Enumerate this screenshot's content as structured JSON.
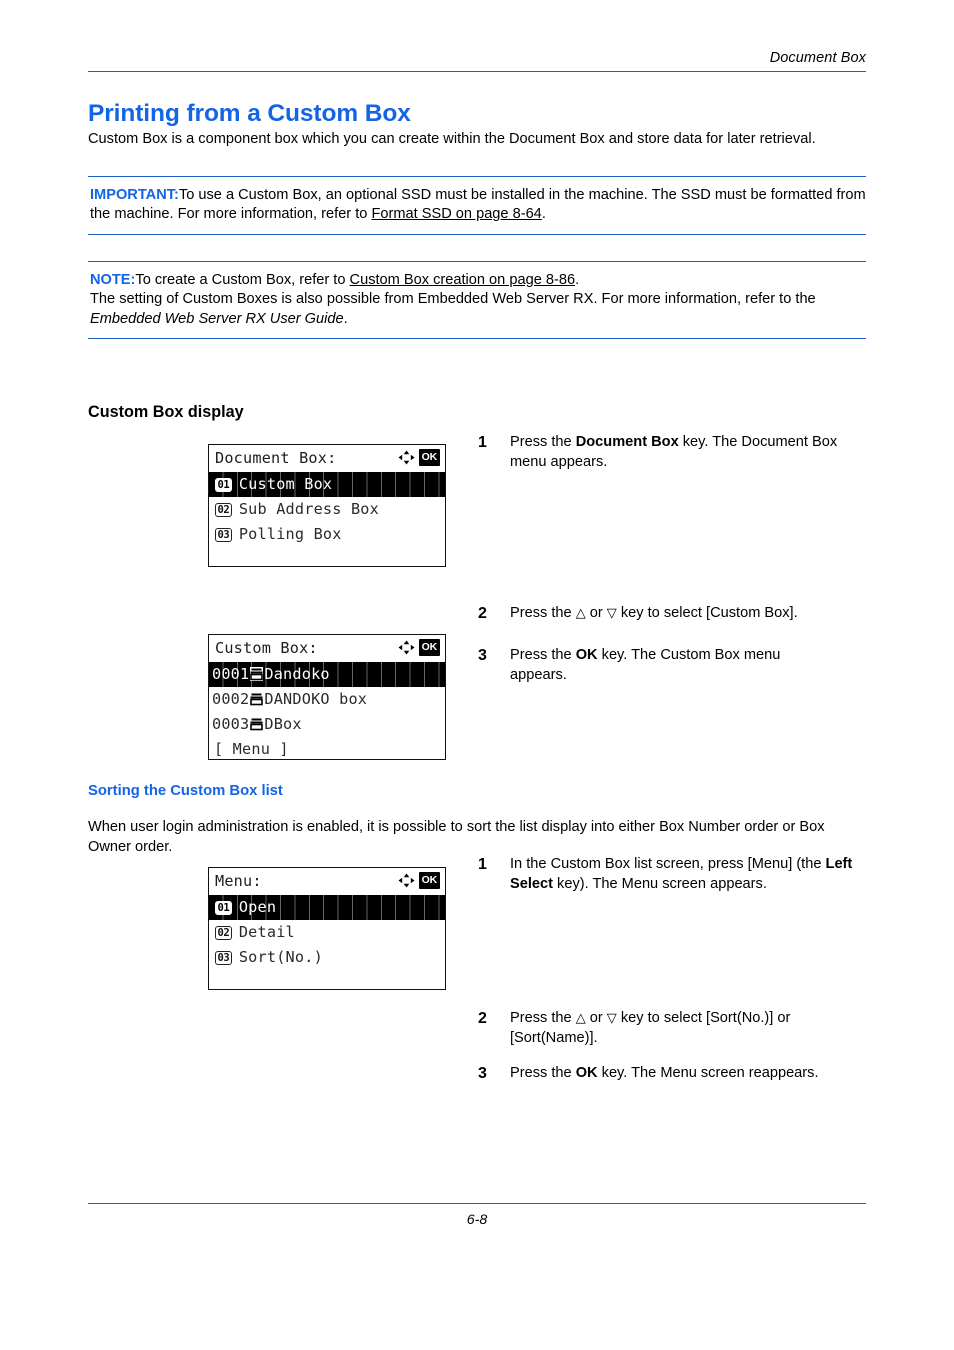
{
  "header": {
    "running_head": "Document Box"
  },
  "title": "Printing from a Custom Box",
  "intro": "Custom Box is a component box which you can create within the Document Box and store data for later retrieval.",
  "important": {
    "label": "IMPORTANT:",
    "text_part1": "To use a Custom Box, an optional SSD must be installed in the machine. The SSD must be formatted from the machine. For more information, refer to ",
    "link": "Format SSD on page 8-64",
    "text_part2": "."
  },
  "note": {
    "label": "NOTE:",
    "line1_part1": "To create a Custom Box, refer to ",
    "line1_link": "Custom Box creation on page 8-86",
    "line1_part2": ".",
    "line2_part1": "The setting of Custom Boxes is also possible from Embedded Web Server RX. For more information, refer to the ",
    "line2_italic": "Embedded Web Server RX User Guide",
    "line2_part2": "."
  },
  "section_custom_box_display": {
    "heading": "Custom Box display",
    "screen": {
      "title": "Document Box:",
      "indicator_arrows": "arrow-cluster-icon",
      "indicator_ok": "OK",
      "rows": [
        {
          "num": "01",
          "label": "Custom Box",
          "selected": true
        },
        {
          "num": "02",
          "label": "Sub Address Box",
          "selected": false
        },
        {
          "num": "03",
          "label": "Polling Box",
          "selected": false
        }
      ]
    },
    "steps": [
      {
        "num": "1",
        "parts": [
          {
            "t": "Press the ",
            "style": "normal"
          },
          {
            "t": "Document Box",
            "style": "bold"
          },
          {
            "t": " key. The Document Box menu appears.",
            "style": "normal"
          }
        ]
      },
      {
        "num": "2",
        "parts": [
          {
            "t": "Press the ",
            "style": "normal"
          },
          {
            "t": "△",
            "style": "tri"
          },
          {
            "t": " or ",
            "style": "normal"
          },
          {
            "t": "▽",
            "style": "tri"
          },
          {
            "t": " key to select [Custom Box].",
            "style": "normal"
          }
        ]
      },
      {
        "num": "3",
        "parts": [
          {
            "t": "Press the ",
            "style": "normal"
          },
          {
            "t": "OK",
            "style": "bold"
          },
          {
            "t": " key. The Custom Box menu appears.",
            "style": "normal"
          }
        ]
      }
    ],
    "screen2": {
      "title": "Custom Box:",
      "indicator_ok": "OK",
      "rows": [
        {
          "num": "0001",
          "label": "Dandoko",
          "icon": "box-glyph",
          "selected": true
        },
        {
          "num": "0002",
          "label": "DANDOKO box",
          "icon": "box-glyph",
          "selected": false
        },
        {
          "num": "0003",
          "label": "DBox",
          "icon": "box-glyph",
          "selected": false
        }
      ],
      "softkey": "[ Menu  ]"
    }
  },
  "section_sorting": {
    "heading": "Sorting the Custom Box list",
    "intro": "When user login administration is enabled, it is possible to sort the list display into either Box Number order or Box Owner order.",
    "screen": {
      "title": "Menu:",
      "indicator_ok": "OK",
      "rows": [
        {
          "num": "01",
          "label": "Open",
          "selected": true
        },
        {
          "num": "02",
          "label": "Detail",
          "selected": false
        },
        {
          "num": "03",
          "label": "Sort(No.)",
          "selected": false
        }
      ]
    },
    "steps": [
      {
        "num": "1",
        "parts": [
          {
            "t": "In the Custom Box list screen, press [Menu] (the ",
            "style": "normal"
          },
          {
            "t": "Left Select",
            "style": "bold"
          },
          {
            "t": " key). The Menu screen appears.",
            "style": "normal"
          }
        ]
      },
      {
        "num": "2",
        "parts": [
          {
            "t": "Press the ",
            "style": "normal"
          },
          {
            "t": "△",
            "style": "tri"
          },
          {
            "t": " or ",
            "style": "normal"
          },
          {
            "t": "▽",
            "style": "tri"
          },
          {
            "t": " key to select [Sort(No.)] or [Sort(Name)].",
            "style": "normal"
          }
        ]
      },
      {
        "num": "3",
        "parts": [
          {
            "t": "Press the ",
            "style": "normal"
          },
          {
            "t": "OK",
            "style": "bold"
          },
          {
            "t": " key. The Menu screen reappears.",
            "style": "normal"
          }
        ]
      }
    ]
  },
  "footer": {
    "page_number": "6-8"
  },
  "colors": {
    "accent_blue": "#1464e6",
    "rule_blue": "#1a5fc4",
    "text_black": "#000000",
    "lcd_background": "#ffffff",
    "lcd_highlight": "#000000"
  }
}
